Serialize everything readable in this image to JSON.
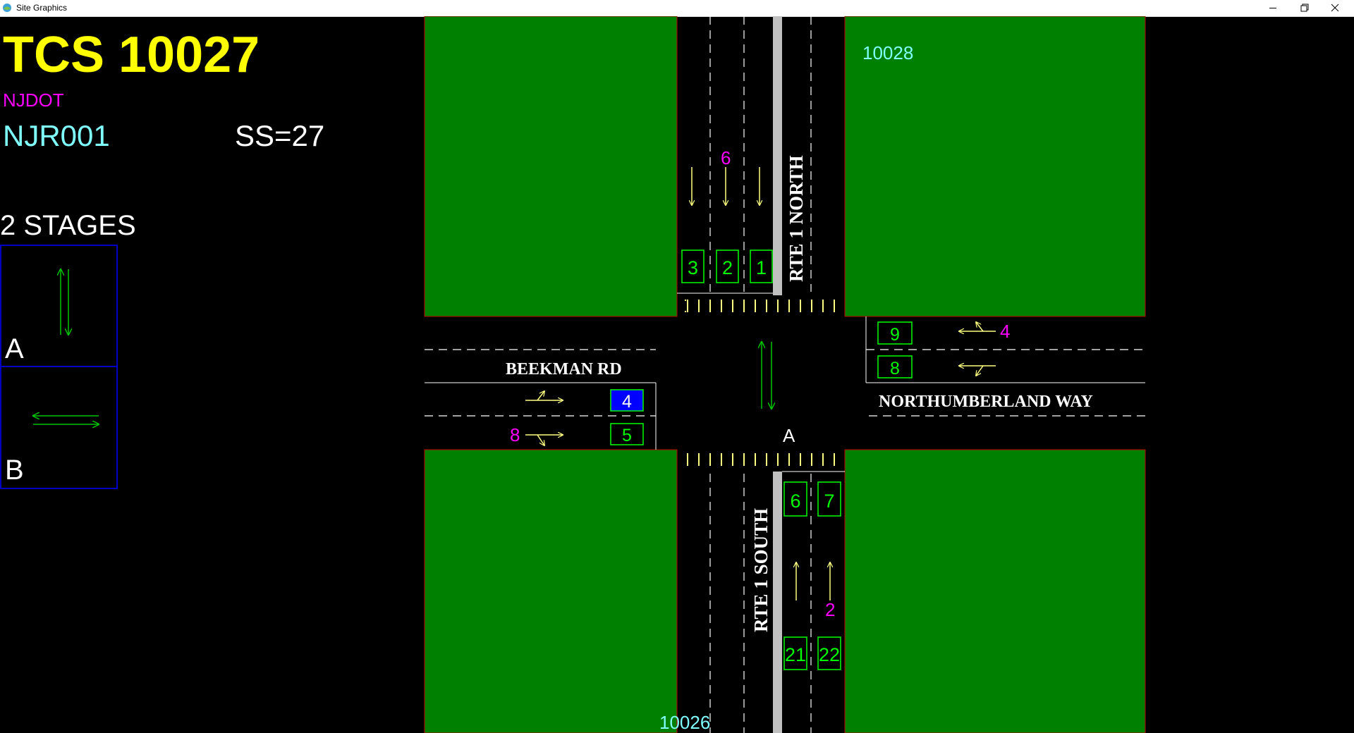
{
  "window": {
    "title": "Site Graphics"
  },
  "header": {
    "tcs": "TCS 10027",
    "agency": "NJDOT",
    "site_code": "NJR001",
    "ss": "SS=27",
    "stages_label": "2 STAGES"
  },
  "stages": [
    {
      "label": "A",
      "movement": "north-south"
    },
    {
      "label": "B",
      "movement": "east-west"
    }
  ],
  "roads": {
    "north": "RTE 1 NORTH",
    "south": "RTE 1 SOUTH",
    "west": "BEEKMAN RD",
    "east": "NORTHUMBERLAND WAY"
  },
  "adjacent_sites": {
    "ne": "10028",
    "s": "10026"
  },
  "current_stage": "A",
  "detectors": {
    "north": [
      "3",
      "2",
      "1"
    ],
    "south": [
      "6",
      "7",
      "21",
      "22"
    ],
    "west": [
      {
        "id": "4",
        "active": true
      },
      {
        "id": "5",
        "active": false
      }
    ],
    "east": [
      "9",
      "8"
    ]
  },
  "phase_labels": {
    "north": "6",
    "south": "2",
    "west": "8",
    "east": "4"
  },
  "colors": {
    "background": "#000000",
    "grass": "#008000",
    "title": "#ffff00",
    "agency": "#ff00ff",
    "site": "#80ffff",
    "detector": "#00ff00",
    "detector_active_fill": "#0000ff",
    "arrow": "#ffff80",
    "stage_arrow": "#00c000",
    "stage_border": "#0000c0",
    "median": "#c0c0c0"
  }
}
